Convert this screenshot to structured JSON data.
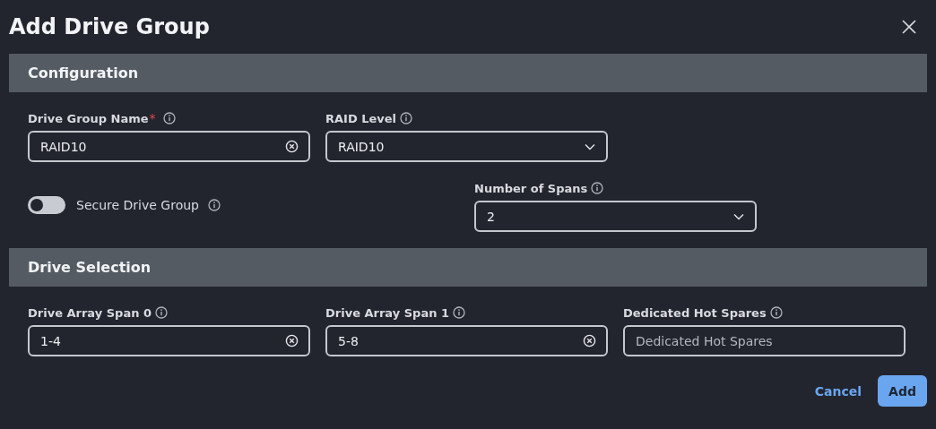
{
  "dialog": {
    "title": "Add Drive Group"
  },
  "sections": [
    {
      "title": "Configuration",
      "rows": [
        [
          {
            "kind": "text",
            "label": "Drive Group Name",
            "required_mark": "*",
            "value": "RAID10",
            "clearable": true
          },
          {
            "kind": "select",
            "label": "RAID Level",
            "value": "RAID10"
          }
        ],
        [
          {
            "kind": "toggle",
            "label": "Secure Drive Group",
            "on": false
          },
          {
            "kind": "select",
            "label": "Number of Spans",
            "value": "2"
          }
        ]
      ]
    },
    {
      "title": "Drive Selection",
      "rows": [
        [
          {
            "kind": "text",
            "label": "Drive Array Span 0",
            "value": "1-4",
            "clearable": true
          },
          {
            "kind": "text",
            "label": "Drive Array Span 1",
            "value": "5-8",
            "clearable": true
          },
          {
            "kind": "text",
            "label": "Dedicated Hot Spares",
            "placeholder": "Dedicated Hot Spares",
            "clearable": false
          }
        ]
      ]
    }
  ],
  "buttons": [
    {
      "label": "Cancel",
      "kind": "secondary"
    },
    {
      "label": "Add",
      "kind": "primary"
    }
  ]
}
